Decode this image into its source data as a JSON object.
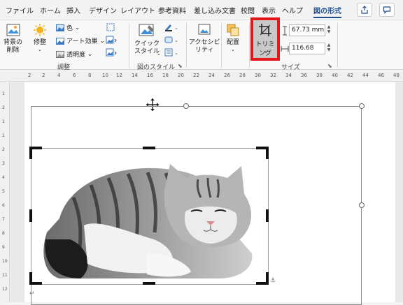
{
  "tabs": [
    {
      "label": "ファイル",
      "name": "tab-file"
    },
    {
      "label": "ホーム",
      "name": "tab-home"
    },
    {
      "label": "挿入",
      "name": "tab-insert"
    },
    {
      "label": "デザイン",
      "name": "tab-design"
    },
    {
      "label": "レイアウト",
      "name": "tab-layout"
    },
    {
      "label": "参考資料",
      "name": "tab-references"
    },
    {
      "label": "差し込み文書",
      "name": "tab-mailings"
    },
    {
      "label": "校閲",
      "name": "tab-review"
    },
    {
      "label": "表示",
      "name": "tab-view"
    },
    {
      "label": "ヘルプ",
      "name": "tab-help"
    },
    {
      "label": "図の形式",
      "name": "tab-picture-format"
    }
  ],
  "ribbon": {
    "remove_bg": "背景の\n削除",
    "corrections": "修整",
    "color": "色",
    "artistic": "アート効果",
    "transparency": "透明度",
    "adjust_group": "調整",
    "quick_styles": "クイック\nスタイル",
    "style_group": "図のスタイル",
    "accessibility": "アクセシビ\nリティ",
    "arrange": "配置",
    "crop": "トリミング",
    "height": "67.73 mm",
    "width": "116.68 mm",
    "size_group": "サイズ"
  },
  "ruler": {
    "h_ticks": [
      "2",
      "2",
      "4",
      "6",
      "8",
      "10",
      "12",
      "14",
      "16",
      "18",
      "20",
      "22",
      "24",
      "26",
      "28",
      "30",
      "32",
      "34",
      "36",
      "38",
      "40",
      "42",
      "44",
      "46",
      "48"
    ],
    "v_ticks": [
      "1",
      "2",
      "1",
      "1",
      "2",
      "3",
      "4",
      "5",
      "6",
      "7",
      "8",
      "9",
      "10",
      "11",
      "12"
    ]
  },
  "document": {
    "paragraph_mark": "↵",
    "anchor_mark": "⚓"
  },
  "colors": {
    "accent": "#1f4e8c",
    "highlight": "#e8161b"
  }
}
